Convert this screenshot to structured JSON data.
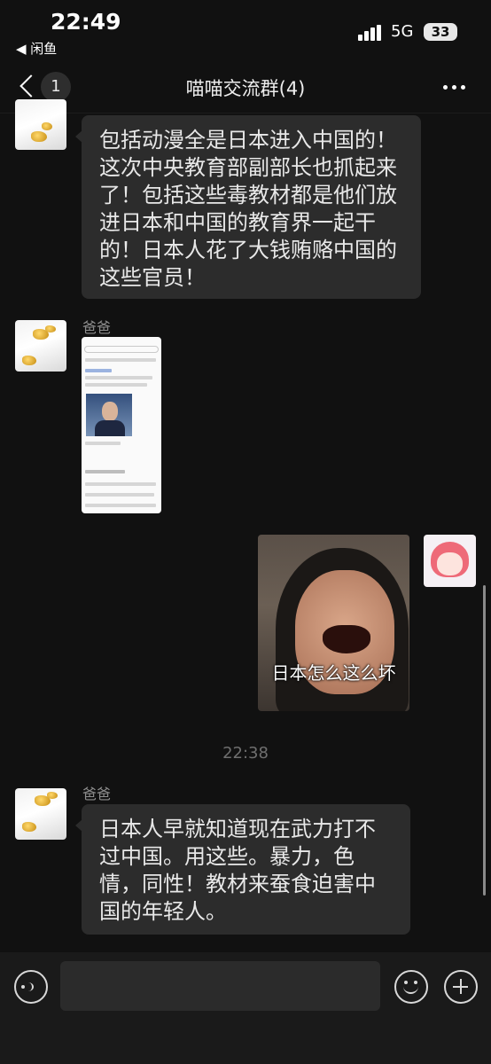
{
  "status_bar": {
    "time": "22:49",
    "back_app": "◀ 闲鱼",
    "network": "5G",
    "battery": "33"
  },
  "nav": {
    "unread_count": "1",
    "title": "喵喵交流群(4)"
  },
  "messages": {
    "m1": {
      "text": "包括动漫全是日本进入中国的！这次中央教育部副部长也抓起来了！包括这些毒教材都是他们放进日本和中国的教育界一起干的！日本人花了大钱贿赂中国的这些官员！"
    },
    "m2": {
      "sender": "爸爸",
      "image": "news-screenshot"
    },
    "m3": {
      "caption": "日本怎么这么坏"
    },
    "time_divider": "22:38",
    "m4": {
      "sender": "爸爸",
      "text": "日本人早就知道现在武力打不过中国。用这些。暴力，色情，同性！教材来蚕食迫害中国的年轻人。"
    }
  },
  "input": {
    "value": "",
    "icons": [
      "voice-icon",
      "emoji-icon",
      "plus-icon"
    ]
  },
  "colors": {
    "background": "#111111",
    "bubble": "#2c2c2c",
    "input_bar": "#1a1a1a"
  }
}
